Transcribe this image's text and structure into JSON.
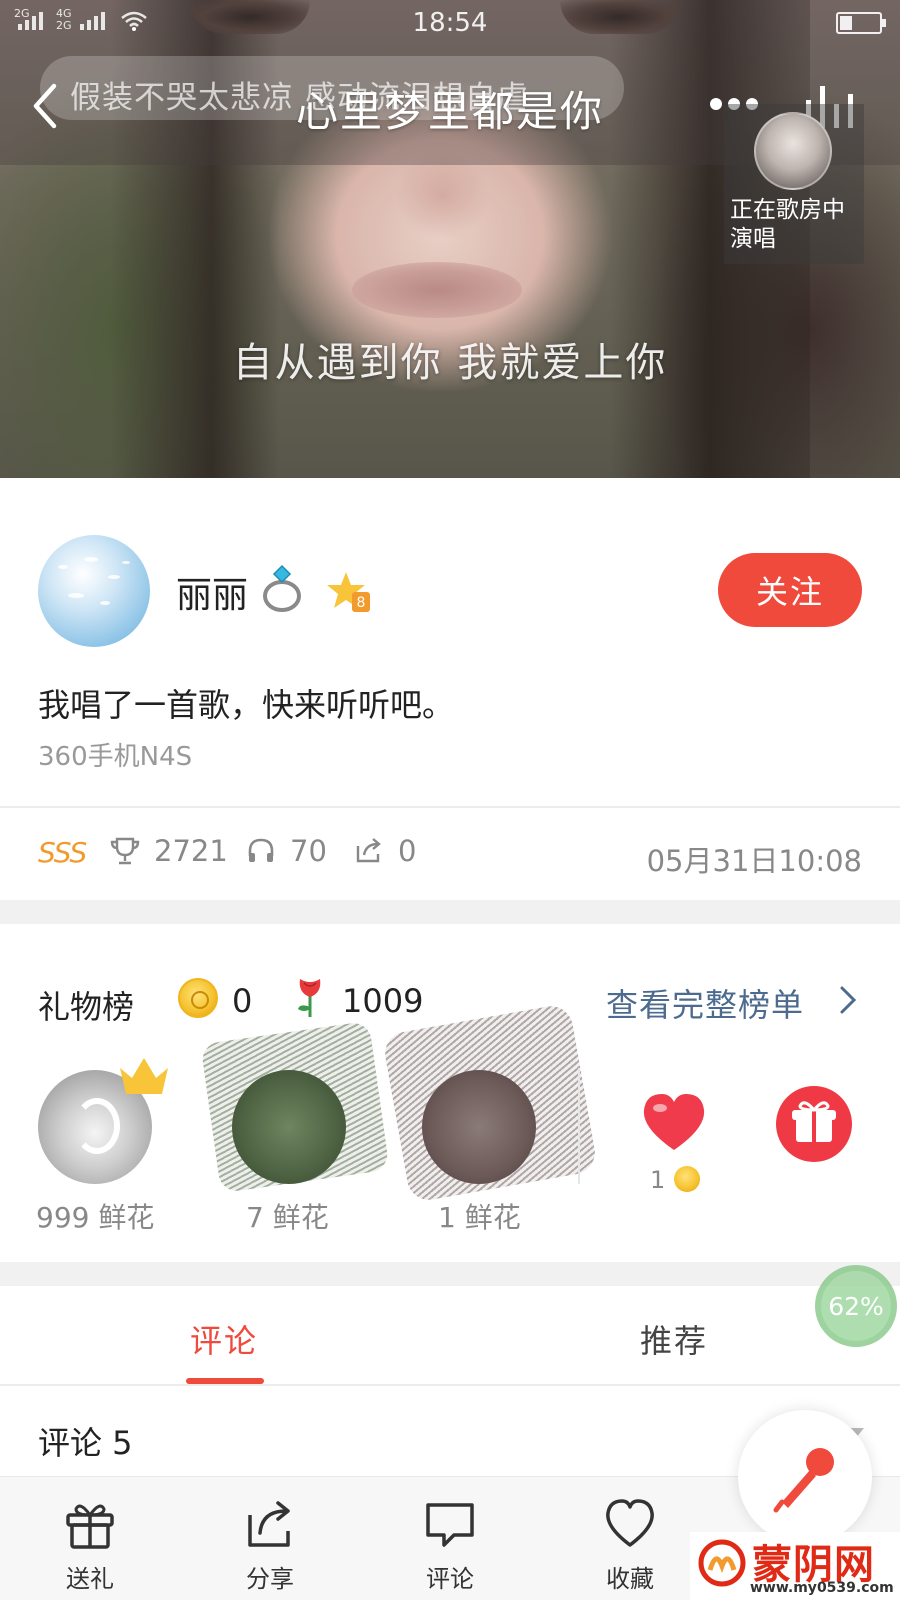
{
  "status_bar": {
    "net_left": "2G",
    "net_right": "4G",
    "net_right_sub": "2G",
    "time": "18:54"
  },
  "player": {
    "previous_lyric": "假装不哭太悲凉  感动流泪想自虐",
    "song_title": "心里梦里都是你",
    "current_lyric": "自从遇到你 我就爱上你",
    "singing_status": "正在歌房中演唱"
  },
  "user": {
    "name": "丽丽",
    "follow_label": "关注",
    "post_text": "我唱了一首歌，快来听听吧。",
    "device": "360手机N4S"
  },
  "stats": {
    "grade": "SSS",
    "trophy_count": "2721",
    "listen_count": "70",
    "share_count": "0",
    "timestamp": "05月31日10:08"
  },
  "gifts": {
    "title": "礼物榜",
    "coin_count": "0",
    "flower_count": "1009",
    "view_full_label": "查看完整榜单",
    "givers": [
      {
        "label": "999 鲜花"
      },
      {
        "label": "7 鲜花"
      },
      {
        "label": "1 鲜花"
      }
    ],
    "heart_count": "1"
  },
  "tabs": [
    {
      "label": "评论"
    },
    {
      "label": "推荐"
    }
  ],
  "progress_badge": "62%",
  "comments": {
    "title": "评论 5"
  },
  "bottom_bar": [
    {
      "label": "送礼",
      "icon": "gift-icon"
    },
    {
      "label": "分享",
      "icon": "share-icon"
    },
    {
      "label": "评论",
      "icon": "comment-icon"
    },
    {
      "label": "收藏",
      "icon": "heart-outline-icon"
    }
  ],
  "watermark": {
    "name": "蒙阴网",
    "url": "www.my0539.com"
  },
  "colors": {
    "accent": "#ef4a3c",
    "link": "#4d6b8e",
    "grade": "#f39a2d"
  }
}
